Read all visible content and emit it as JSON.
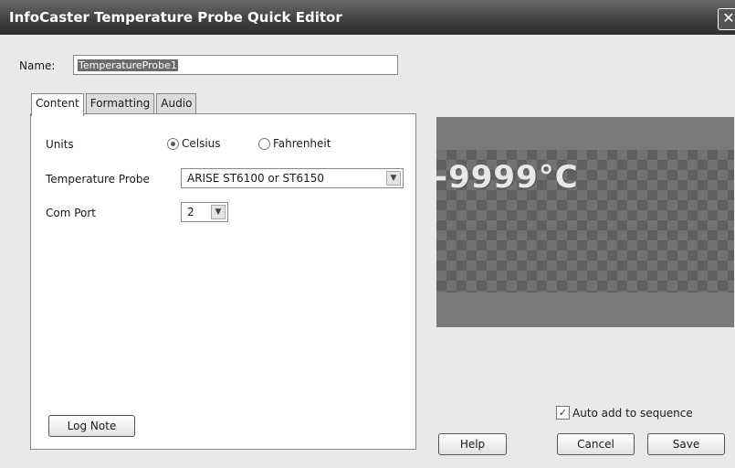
{
  "window": {
    "title": "InfoCaster Temperature Probe Quick Editor",
    "close_glyph": "✕"
  },
  "name": {
    "label": "Name:",
    "value": "TemperatureProbe1"
  },
  "tabs": [
    {
      "label": "Content"
    },
    {
      "label": "Formatting"
    },
    {
      "label": "Audio"
    }
  ],
  "content": {
    "units_label": "Units",
    "units_options": [
      {
        "label": "Celsius",
        "selected": true
      },
      {
        "label": "Fahrenheit",
        "selected": false
      }
    ],
    "probe_label": "Temperature Probe",
    "probe_value": "ARISE ST6100 or ST6150",
    "comport_label": "Com Port",
    "comport_value": "2",
    "log_note_label": "Log Note"
  },
  "preview": {
    "text": "-9999°C"
  },
  "auto_add": {
    "label": "Auto add to sequence",
    "checked": true,
    "check_glyph": "✓"
  },
  "buttons": {
    "help": "Help",
    "cancel": "Cancel",
    "save": "Save"
  },
  "icons": {
    "dropdown": "▼"
  }
}
